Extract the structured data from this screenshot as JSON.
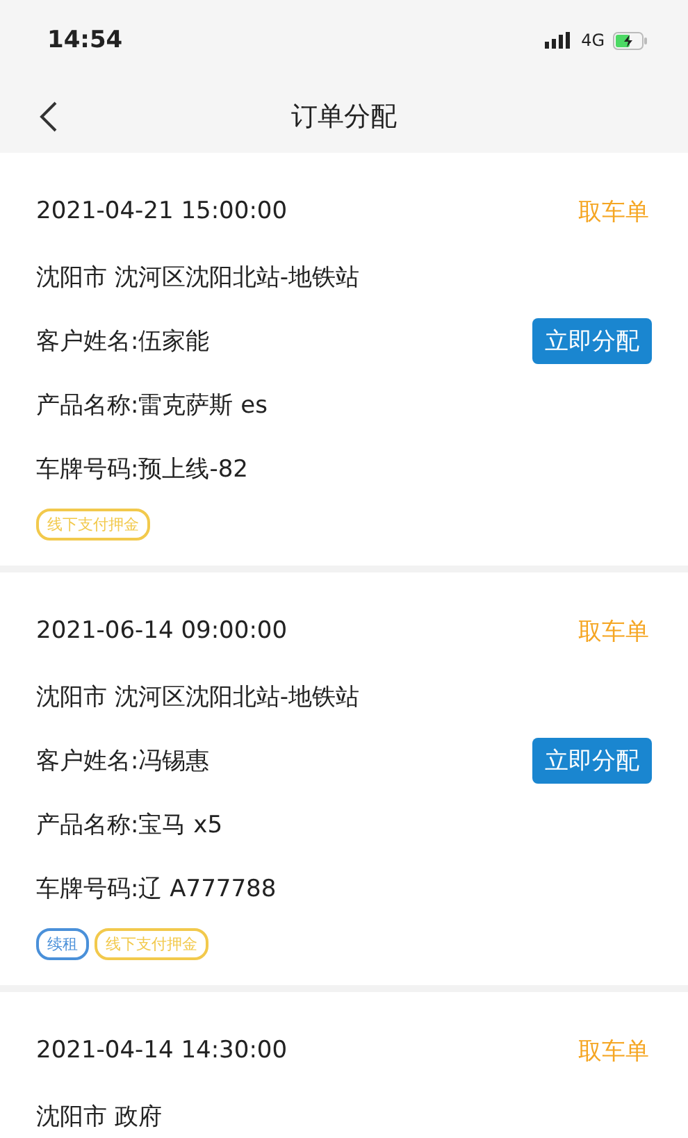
{
  "status_bar": {
    "time": "14:54",
    "network": "4G"
  },
  "nav": {
    "title": "订单分配"
  },
  "orders": [
    {
      "datetime": "2021-04-21 15:00:00",
      "type_label": "取车单",
      "address": "沈阳市 沈河区沈阳北站-地铁站",
      "customer": "客户姓名:伍家能",
      "action": "立即分配",
      "product": "产品名称:雷克萨斯 es",
      "plate": "车牌号码:预上线-82",
      "tags": [
        {
          "label": "线下支付押金",
          "color": "#f2c94c"
        }
      ]
    },
    {
      "datetime": "2021-06-14 09:00:00",
      "type_label": "取车单",
      "address": "沈阳市 沈河区沈阳北站-地铁站",
      "customer": "客户姓名:冯锡惠",
      "action": "立即分配",
      "product": "产品名称:宝马 x5",
      "plate": "车牌号码:辽 A777788",
      "tags": [
        {
          "label": "续租",
          "color": "#4a90d9"
        },
        {
          "label": "线下支付押金",
          "color": "#f2c94c"
        }
      ]
    },
    {
      "datetime": "2021-04-14 14:30:00",
      "type_label": "取车单",
      "address": "沈阳市 政府"
    }
  ]
}
